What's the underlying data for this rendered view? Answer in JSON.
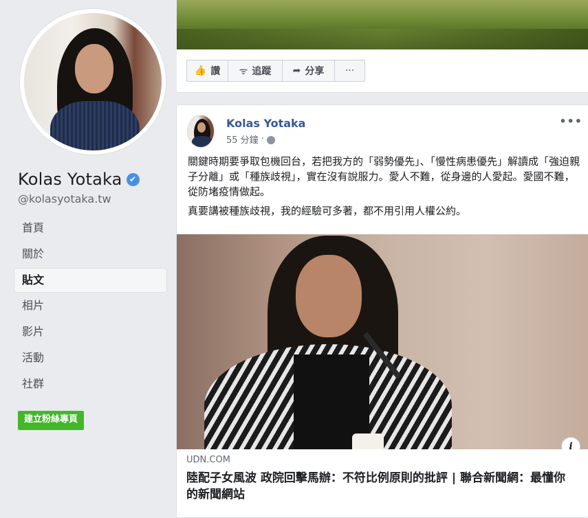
{
  "profile": {
    "name": "Kolas Yotaka",
    "username": "@kolasyotaka.tw",
    "verified_icon": "✔"
  },
  "nav": {
    "items": [
      "首頁",
      "關於",
      "貼文",
      "相片",
      "影片",
      "活動",
      "社群"
    ],
    "active": "貼文"
  },
  "create_page_button": "建立粉絲專頁",
  "top_card": {
    "actions": [
      {
        "label": "讚",
        "icon": "thumbs-up-icon",
        "glyph": "👍"
      },
      {
        "label": "追蹤",
        "icon": "rss-icon",
        "glyph": "ᯤ"
      },
      {
        "label": "分享",
        "icon": "share-icon",
        "glyph": "➦"
      },
      {
        "label": "",
        "icon": "more-icon",
        "glyph": "···"
      }
    ]
  },
  "post": {
    "author": "Kolas Yotaka",
    "time": "55 分鐘",
    "separator": "·",
    "more": "•••",
    "paragraphs": [
      "關鍵時期要爭取包機回台，若把我方的「弱勢優先」、「慢性病患優先」解讀成「強迫親子分離」或「種族歧視」，實在沒有說服力。愛人不難，從身邊的人愛起。愛國不難，從防堵疫情做起。",
      "真要講被種族歧視，我的經驗可多著，都不用引用人權公約。"
    ],
    "link": {
      "source": "UDN.COM",
      "title": "陸配子女風波 政院回擊馬辦：不符比例原則的批評 | 聯合新聞網：最懂你的新聞網站",
      "info": "i"
    }
  },
  "colors": {
    "background": "#e9ebee",
    "link_blue": "#385898",
    "green_button": "#42b72a",
    "verified_blue": "#4a90e2"
  }
}
